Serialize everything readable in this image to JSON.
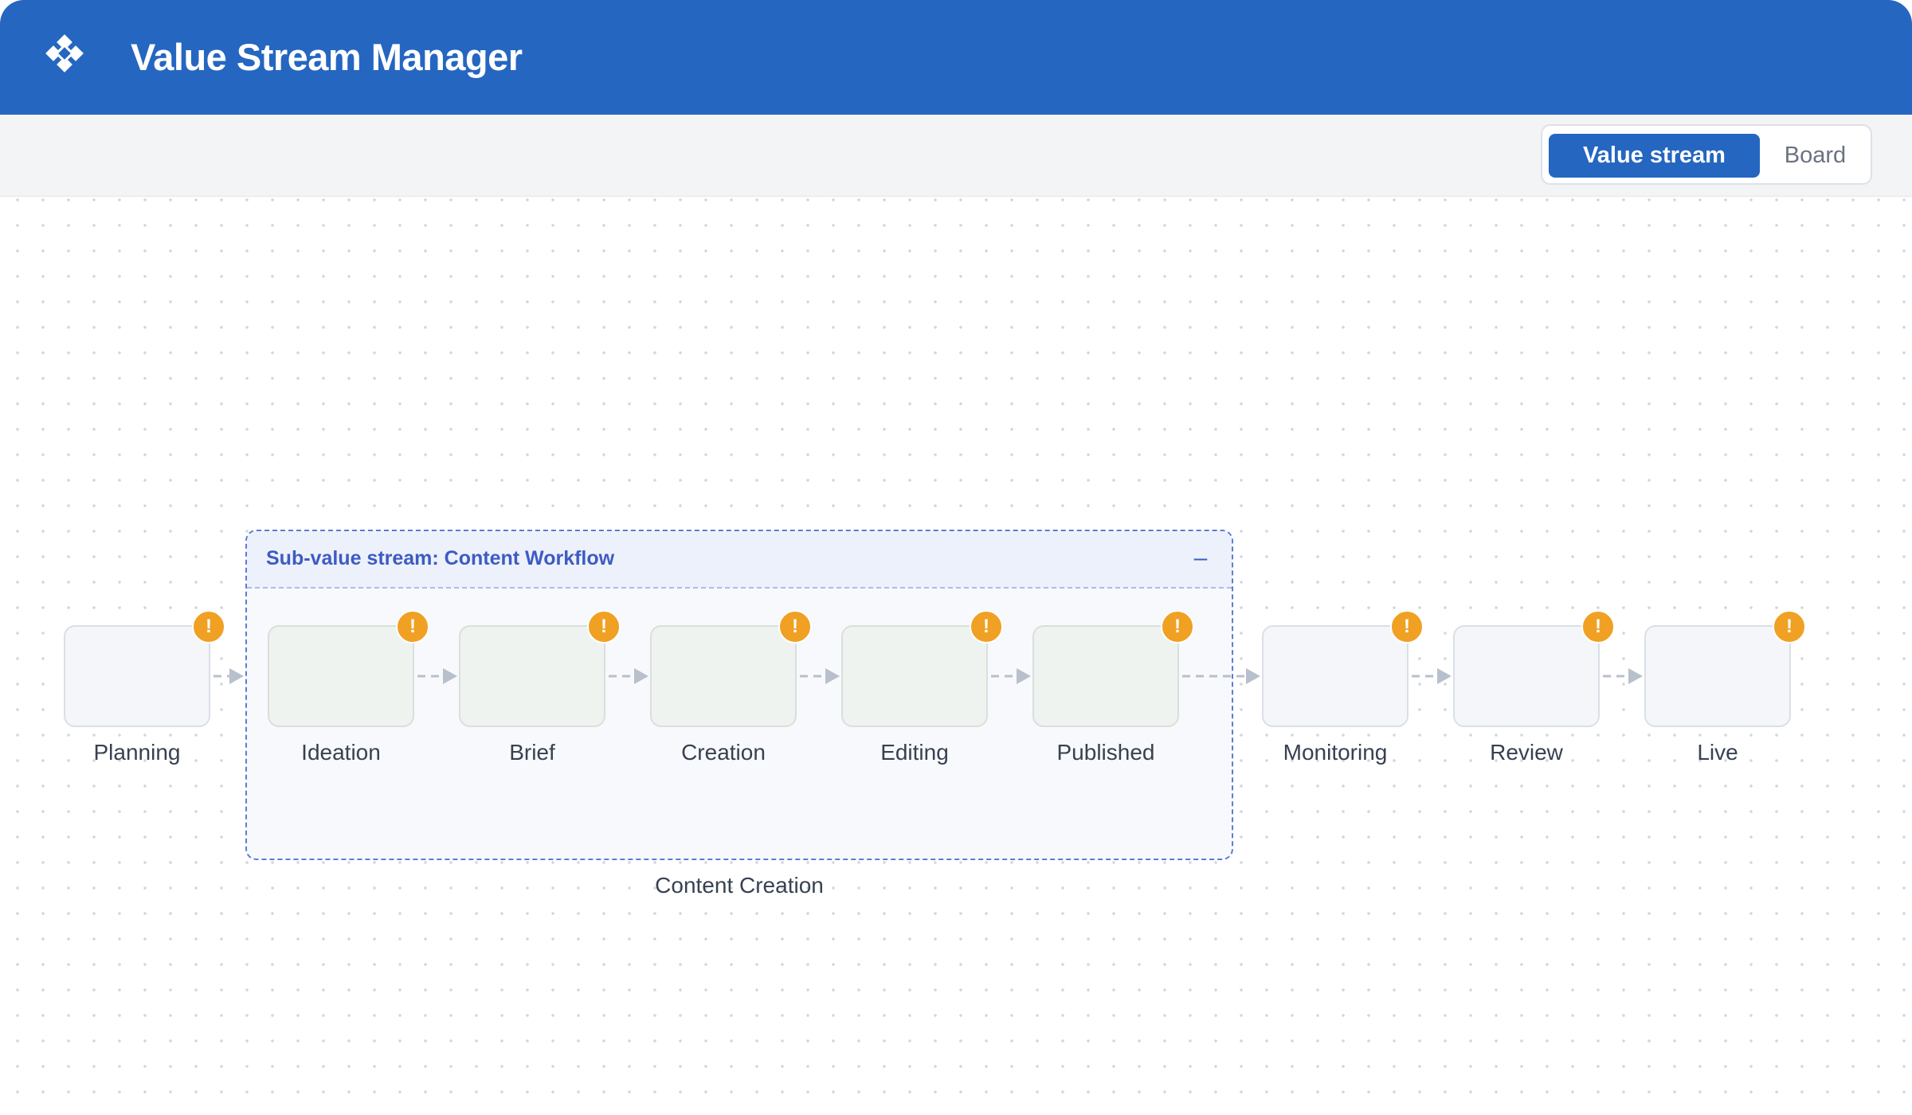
{
  "app": {
    "title": "Value Stream Manager",
    "logo_icon": "diamond-grid-icon",
    "brand_color": "#2566C1"
  },
  "toolbar": {
    "view_toggle": {
      "options": [
        "Value stream",
        "Board"
      ],
      "selected": "Value stream"
    }
  },
  "canvas": {
    "subgroup": {
      "title": "Sub-value stream: Content Workflow",
      "collapse_symbol": "–",
      "label": "Content Creation"
    },
    "stages": [
      {
        "name": "Planning",
        "in_subgroup": false,
        "warning": "!"
      },
      {
        "name": "Ideation",
        "in_subgroup": true,
        "warning": "!"
      },
      {
        "name": "Brief",
        "in_subgroup": true,
        "warning": "!"
      },
      {
        "name": "Creation",
        "in_subgroup": true,
        "warning": "!"
      },
      {
        "name": "Editing",
        "in_subgroup": true,
        "warning": "!"
      },
      {
        "name": "Published",
        "in_subgroup": true,
        "warning": "!"
      },
      {
        "name": "Monitoring",
        "in_subgroup": false,
        "warning": "!"
      },
      {
        "name": "Review",
        "in_subgroup": false,
        "warning": "!"
      },
      {
        "name": "Live",
        "in_subgroup": false,
        "warning": "!"
      }
    ],
    "warning_color": "#F0A023",
    "connector_icon": "dashed-arrow-icon"
  }
}
